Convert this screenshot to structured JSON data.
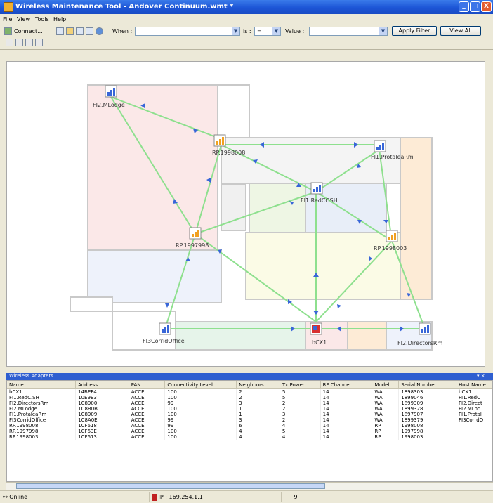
{
  "window": {
    "title": "Wireless Maintenance Tool - Andover Continuum.wmt *",
    "min": "_",
    "max": "□",
    "close": "X"
  },
  "menu": [
    "File",
    "View",
    "Tools",
    "Help"
  ],
  "toolbar": {
    "connect_label": "Connect...",
    "when_label": "When :",
    "is_label": "is :",
    "is_value": "=",
    "value_label": "Value :",
    "apply_filter": "Apply Filter",
    "view_all": "View All"
  },
  "map_nodes": [
    {
      "label": "FI2.MLodge",
      "type": "blue"
    },
    {
      "label": "RP.1998008",
      "type": "orange"
    },
    {
      "label": "FI1.ProtaleaRm",
      "type": "blue"
    },
    {
      "label": "FI1.RedCOSH",
      "type": "blue"
    },
    {
      "label": "RP.1997998",
      "type": "orange"
    },
    {
      "label": "RP.1998003",
      "type": "orange"
    },
    {
      "label": "FI3CorridOffice",
      "type": "blue"
    },
    {
      "label": "bCX1",
      "type": "red"
    },
    {
      "label": "FI2.DirectorsRm",
      "type": "blue"
    }
  ],
  "adapters_panel": {
    "title": "Wireless Adapters",
    "pin": "▾ ×",
    "columns": [
      "Name",
      "Address",
      "PAN",
      "Connectivity Level",
      "Neighbors",
      "Tx Power",
      "RF Channel",
      "Model",
      "Serial Number",
      "Host Name"
    ],
    "rows": [
      [
        "bCX1",
        "14BEF4",
        "ACCE",
        "100",
        "2",
        "5",
        "14",
        "WA",
        "1898303",
        "bCX1"
      ],
      [
        "FI1.RedC.SH",
        "10E9E3",
        "ACCE",
        "100",
        "2",
        "5",
        "14",
        "WA",
        "1899046",
        "FI1.RedC"
      ],
      [
        "FI2.DirectorsRm",
        "1C8900",
        "ACCE",
        "99",
        "3",
        "2",
        "14",
        "WA",
        "1899309",
        "FI2.Direct"
      ],
      [
        "FI2.MLodge",
        "1C8B0B",
        "ACCE",
        "100",
        "1",
        "2",
        "14",
        "WA",
        "1899328",
        "FI2.MLod"
      ],
      [
        "FI1.ProtaleaRm",
        "1C8909",
        "ACCE",
        "100",
        "1",
        "3",
        "14",
        "WA",
        "1897907",
        "FI1.Protal"
      ],
      [
        "FI3CorridOffice",
        "1C8A0E",
        "ACCE",
        "99",
        "3",
        "2",
        "14",
        "WA",
        "1899379",
        "FI3CorrdO"
      ],
      [
        "RP.1998008",
        "1CF618",
        "ACCE",
        "99",
        "6",
        "4",
        "14",
        "RP",
        "1998008",
        ""
      ],
      [
        "RP.1997998",
        "1CF63E",
        "ACCE",
        "100",
        "4",
        "5",
        "14",
        "RP",
        "1997998",
        ""
      ],
      [
        "RP.1998003",
        "1CF613",
        "ACCE",
        "100",
        "4",
        "4",
        "14",
        "RP",
        "1998003",
        ""
      ]
    ]
  },
  "status": {
    "state": "Online",
    "ip": "IP : 169.254.1.1",
    "count": "9"
  }
}
